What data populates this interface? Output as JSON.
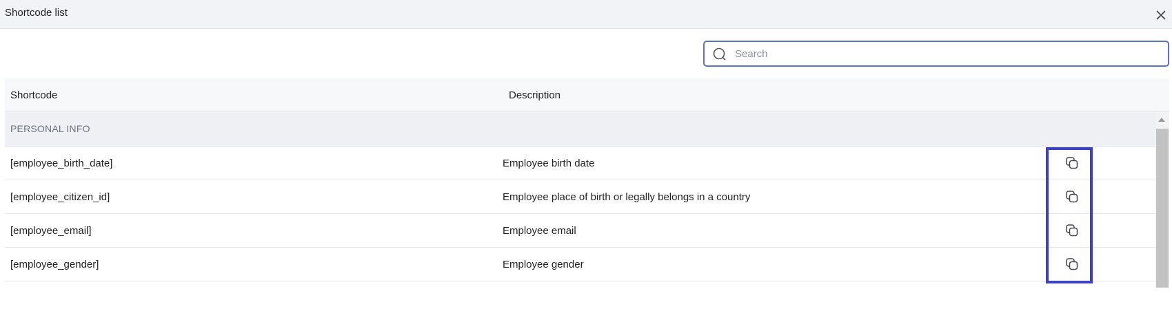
{
  "dialog": {
    "title": "Shortcode list"
  },
  "search": {
    "placeholder": "Search",
    "value": ""
  },
  "table": {
    "columns": [
      "Shortcode",
      "Description"
    ],
    "group": "PERSONAL INFO",
    "rows": [
      {
        "code": "[employee_birth_date]",
        "description": "Employee birth date"
      },
      {
        "code": "[employee_citizen_id]",
        "description": "Employee place of birth or legally belongs in a country"
      },
      {
        "code": "[employee_email]",
        "description": "Employee email"
      },
      {
        "code": "[employee_gender]",
        "description": "Employee gender"
      }
    ]
  },
  "icons": {
    "close": "close-icon",
    "search": "search-icon",
    "copy": "copy-icon"
  },
  "colors": {
    "accent": "#5b6fd6",
    "highlight": "#3b3fd0",
    "header_bg": "#f1f3f6",
    "group_bg": "#eef0f3"
  }
}
